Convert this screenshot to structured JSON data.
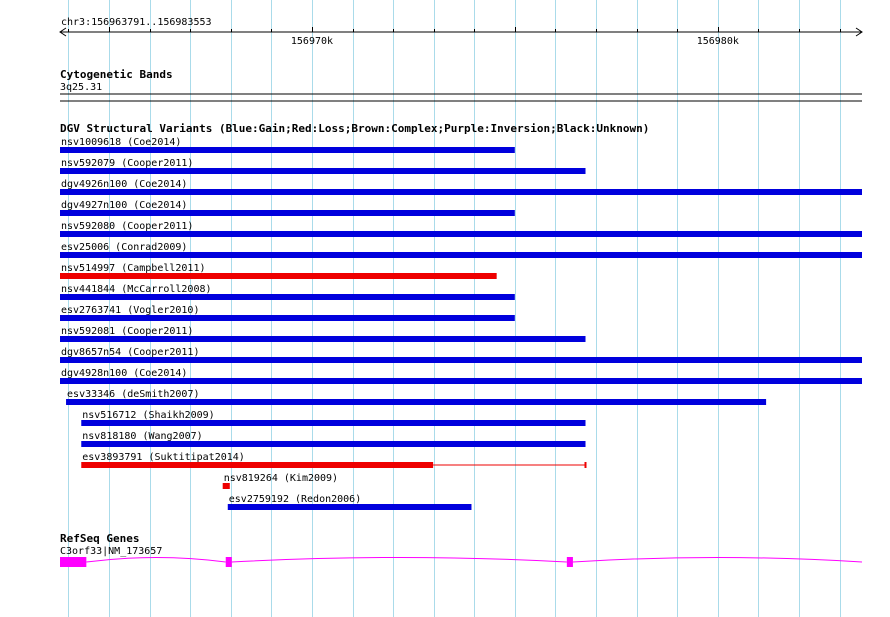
{
  "ruler": {
    "label": "chr3:156963791..156983553",
    "start": 156963791,
    "end": 156983553,
    "major_ticks": [
      {
        "label": "156970k",
        "value": 156970000
      },
      {
        "label": "156980k",
        "value": 156980000
      }
    ]
  },
  "cytoband": {
    "title": "Cytogenetic Bands",
    "band": "3q25.31"
  },
  "dgv": {
    "title": "DGV Structural Variants (Blue:Gain;Red:Loss;Brown:Complex;Purple:Inversion;Black:Unknown)",
    "colors": {
      "gain": "#0000dd",
      "loss": "#ee0000"
    },
    "variants": [
      {
        "label": "nsv1009618 (Coe2014)",
        "type": "gain",
        "start": 156963791,
        "end": 156974998
      },
      {
        "label": "nsv592079 (Cooper2011)",
        "type": "gain",
        "start": 156963791,
        "end": 156976740
      },
      {
        "label": "dgv4926n100 (Coe2014)",
        "type": "gain",
        "start": 156963791,
        "end": 156983553
      },
      {
        "label": "dgv4927n100 (Coe2014)",
        "type": "gain",
        "start": 156963791,
        "end": 156974998
      },
      {
        "label": "nsv592080 (Cooper2011)",
        "type": "gain",
        "start": 156963791,
        "end": 156983553
      },
      {
        "label": "esv25006 (Conrad2009)",
        "type": "gain",
        "start": 156963791,
        "end": 156983553
      },
      {
        "label": "nsv514997 (Campbell2011)",
        "type": "loss",
        "start": 156963791,
        "end": 156974551
      },
      {
        "label": "nsv441844 (McCarroll2008)",
        "type": "gain",
        "start": 156963791,
        "end": 156974998
      },
      {
        "label": "esv2763741 (Vogler2010)",
        "type": "gain",
        "start": 156963791,
        "end": 156974998
      },
      {
        "label": "nsv592081 (Cooper2011)",
        "type": "gain",
        "start": 156963791,
        "end": 156976740
      },
      {
        "label": "dgv8657n54 (Cooper2011)",
        "type": "gain",
        "start": 156963791,
        "end": 156983553
      },
      {
        "label": "dgv4928n100 (Coe2014)",
        "type": "gain",
        "start": 156963791,
        "end": 156983553
      },
      {
        "label": "esv33346 (deSmith2007)",
        "type": "gain",
        "start": 156963940,
        "end": 156981190
      },
      {
        "label": "nsv516712 (Shaikh2009)",
        "type": "gain",
        "start": 156964315,
        "end": 156976740
      },
      {
        "label": "nsv818180 (Wang2007)",
        "type": "gain",
        "start": 156964315,
        "end": 156976740
      },
      {
        "label": "esv3893791 (Suktitipat2014)",
        "type": "loss",
        "start": 156964315,
        "end": 156976740,
        "thick_end": 156972985
      },
      {
        "label": "nsv819264 (Kim2009)",
        "type": "loss",
        "start": 156967800,
        "end": 156967975
      },
      {
        "label": "esv2759192 (Redon2006)",
        "type": "gain",
        "start": 156967925,
        "end": 156973930
      }
    ]
  },
  "refseq": {
    "title": "RefSeq Genes",
    "gene_label": "C3orf33|NM_173657",
    "color": "#ff00ff",
    "tx_start": 156963791,
    "tx_end": 156983553,
    "exons": [
      {
        "start": 156963791,
        "end": 156964440
      },
      {
        "start": 156967875,
        "end": 156968025
      },
      {
        "start": 156976280,
        "end": 156976430
      }
    ]
  }
}
